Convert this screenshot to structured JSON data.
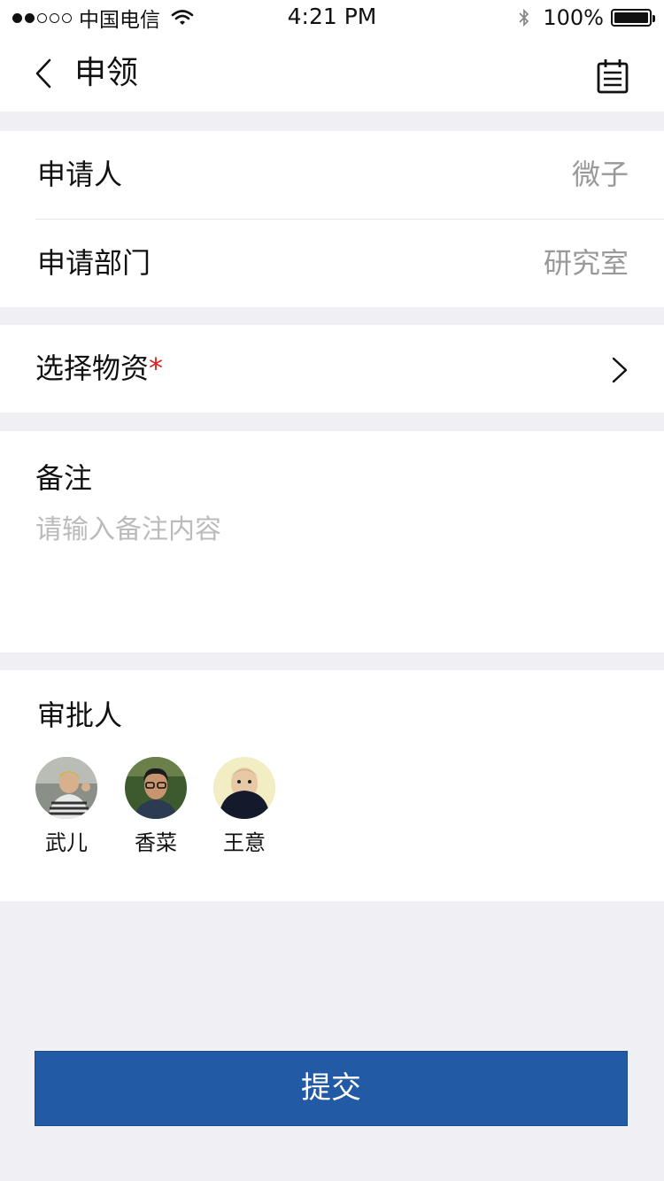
{
  "status_bar": {
    "carrier": "中国电信",
    "time": "4:21 PM",
    "battery": "100%",
    "battery_level": 1.0
  },
  "nav": {
    "title": "申领",
    "back_icon": "chevron-left-icon",
    "calendar_icon": "calendar-list-icon"
  },
  "form": {
    "applicant_label": "申请人",
    "applicant_value": "微子",
    "department_label": "申请部门",
    "department_value": "研究室",
    "material_label": "选择物资",
    "material_required": "*",
    "remark_label": "备注",
    "remark_placeholder": "请输入备注内容"
  },
  "approvers": {
    "label": "审批人",
    "people": [
      {
        "name": "武儿"
      },
      {
        "name": "香菜"
      },
      {
        "name": "王意"
      }
    ]
  },
  "submit_label": "提交",
  "colors": {
    "primary": "#235aa6",
    "background": "#efeff4",
    "required": "#e02020",
    "muted": "#999999"
  }
}
